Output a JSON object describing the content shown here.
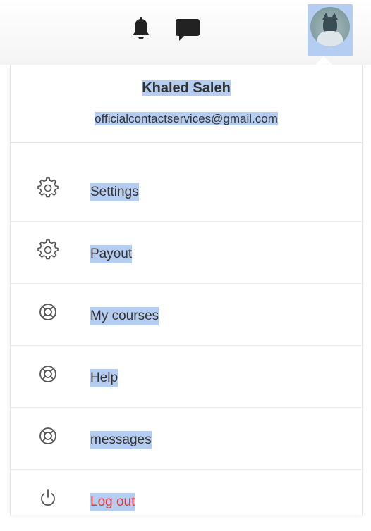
{
  "header": {
    "notifications_icon": "bell-icon",
    "messages_icon": "chat-icon",
    "avatar": "user-avatar"
  },
  "profile": {
    "name": "Khaled Saleh",
    "email": "officialcontactservices@gmail.com"
  },
  "menu": {
    "items": [
      {
        "label": "Settings",
        "icon": "gear-icon"
      },
      {
        "label": "Payout",
        "icon": "gear-icon"
      },
      {
        "label": "My courses",
        "icon": "lifebuoy-icon"
      },
      {
        "label": "Help",
        "icon": "lifebuoy-icon"
      },
      {
        "label": "messages",
        "icon": "lifebuoy-icon"
      },
      {
        "label": "Log out",
        "icon": "power-icon"
      }
    ]
  },
  "colors": {
    "selection_highlight": "#b6cdf2",
    "logout_text": "#e53935",
    "text": "#333333"
  }
}
